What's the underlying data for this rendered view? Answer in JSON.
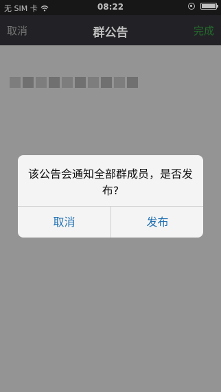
{
  "status_bar": {
    "carrier": "无 SIM 卡",
    "time": "08:22",
    "icons": [
      "wifi-icon",
      "rotation-lock-icon",
      "battery-icon"
    ]
  },
  "nav": {
    "cancel_label": "取消",
    "title": "群公告",
    "done_label": "完成",
    "colors": {
      "bar": "#2e2e33",
      "done": "#2f8f3a",
      "cancel": "#9a9a9a"
    }
  },
  "dialog": {
    "message": "该公告会通知全部群成员，是否发布?",
    "cancel_label": "取消",
    "confirm_label": "发布",
    "button_color": "#1f6fb2"
  }
}
